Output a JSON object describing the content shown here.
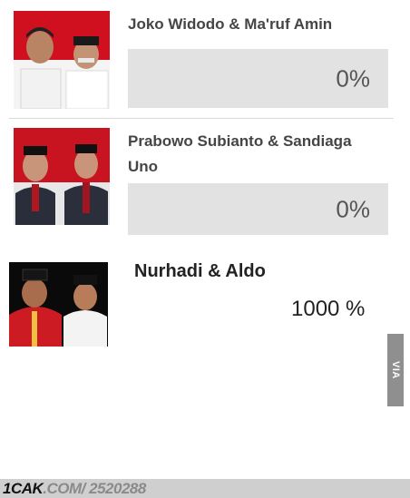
{
  "candidates": [
    {
      "name": "Joko Widodo & Ma'ruf Amin",
      "percent": "0%",
      "photo": "candidate-pair-1-photo"
    },
    {
      "name_line1": "Prabowo Subianto & Sandiaga",
      "name_line2": "Uno",
      "percent": "0%",
      "photo": "candidate-pair-2-photo"
    },
    {
      "name": "Nurhadi & Aldo",
      "percent": "1000 %",
      "photo": "candidate-pair-3-photo"
    }
  ],
  "watermark": {
    "side_text": "VIA 1CAK.COM",
    "footer_brand": "1CAK",
    "footer_path": ".COM/ 2520288"
  },
  "colors": {
    "bar_background": "#e2e2e2",
    "flag_red": "#c8102e",
    "text_dark": "#454545"
  }
}
